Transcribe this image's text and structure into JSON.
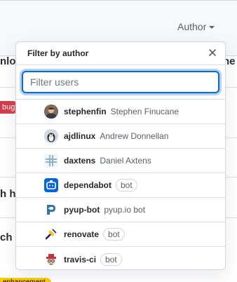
{
  "background": {
    "author_filter_label": "Author",
    "row_fragments": [
      "nlo",
      "ne",
      "h ha",
      "ch n"
    ],
    "labels": {
      "bug": "bug",
      "enhancement": "enhancement"
    }
  },
  "dropdown": {
    "title": "Filter by author",
    "search": {
      "placeholder": "Filter users",
      "value": ""
    },
    "users": [
      {
        "login": "stephenfin",
        "name": "Stephen Finucane",
        "bot": "",
        "avatar_icon": "photo-avatar"
      },
      {
        "login": "ajdlinux",
        "name": "Andrew Donnellan",
        "bot": "",
        "avatar_icon": "photo-avatar"
      },
      {
        "login": "daxtens",
        "name": "Daniel Axtens",
        "bot": "",
        "avatar_icon": "identicon-avatar"
      },
      {
        "login": "dependabot",
        "name": "",
        "bot": "bot",
        "avatar_icon": "dependabot-icon"
      },
      {
        "login": "pyup-bot",
        "name": "pyup.io bot",
        "bot": "",
        "avatar_icon": "pyup-icon"
      },
      {
        "login": "renovate",
        "name": "",
        "bot": "bot",
        "avatar_icon": "renovate-icon"
      },
      {
        "login": "travis-ci",
        "name": "",
        "bot": "bot",
        "avatar_icon": "travis-icon"
      }
    ]
  },
  "colors": {
    "accent": "#0969da",
    "bug_label": "#d73a4a",
    "enhancement_label": "#fbca04",
    "dependabot": "#0366d6",
    "pyup": "#2f78a5"
  }
}
